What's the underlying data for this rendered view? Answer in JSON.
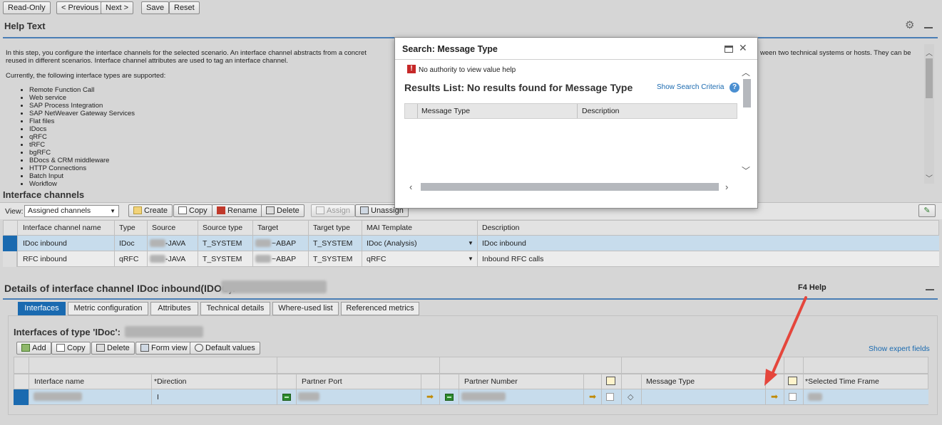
{
  "toolbar": {
    "readonly": "Read-Only",
    "previous": "< Previous",
    "next": "Next >",
    "save": "Save",
    "reset": "Reset"
  },
  "help": {
    "title": "Help Text",
    "para1_left": "In this step, you configure the interface channels for the selected scenario. An interface channel abstracts from a concret",
    "para1_right": "ween two technical systems or hosts. They can be",
    "para1_line2": "reused in different scenarios. Interface channel attributes are used to tag an interface channel.",
    "para2": "Currently, the following interface types are supported:",
    "types": [
      "Remote Function Call",
      "Web service",
      "SAP Process Integration",
      "SAP NetWeaver Gateway Services",
      "Flat files",
      "IDocs",
      "qRFC",
      "tRFC",
      "bgRFC",
      "BDocs & CRM middleware",
      "HTTP Connections",
      "Batch Input",
      "Workflow"
    ]
  },
  "channels": {
    "title": "Interface channels",
    "view_label": "View:",
    "view_value": "Assigned channels",
    "buttons": {
      "create": "Create",
      "copy": "Copy",
      "rename": "Rename",
      "delete": "Delete",
      "assign": "Assign",
      "unassign": "Unassign"
    },
    "columns": [
      "Interface channel name",
      "Type",
      "Source",
      "Source type",
      "Target",
      "Target type",
      "MAI Template",
      "Description"
    ],
    "rows": [
      {
        "name": "IDoc inbound",
        "type": "IDoc",
        "source": "-JAVA",
        "source_type": "T_SYSTEM",
        "target": "~ABAP",
        "target_type": "T_SYSTEM",
        "template": "IDoc (Analysis)",
        "description": "IDoc inbound"
      },
      {
        "name": "RFC inbound",
        "type": "qRFC",
        "source": "-JAVA",
        "source_type": "T_SYSTEM",
        "target": "~ABAP",
        "target_type": "T_SYSTEM",
        "template": "qRFC",
        "description": "Inbound RFC calls"
      }
    ]
  },
  "details": {
    "title": "Details of interface channel IDoc inbound(IDOC):",
    "annotation": "F4 Help",
    "tabs": [
      "Interfaces",
      "Metric configuration",
      "Attributes",
      "Technical details",
      "Where-used list",
      "Referenced metrics"
    ],
    "subtitle": "Interfaces of type 'IDoc':",
    "buttons": {
      "add": "Add",
      "copy": "Copy",
      "delete": "Delete",
      "form_view": "Form view",
      "default_values": "Default values"
    },
    "show_expert": "Show expert fields",
    "columns": {
      "interface_name": "Interface name",
      "direction": "*Direction",
      "partner_port": "Partner Port",
      "partner_number": "Partner Number",
      "message_type": "Message Type",
      "time_frame": "*Selected Time Frame"
    },
    "row": {
      "direction": "I"
    }
  },
  "dialog": {
    "title": "Search: Message Type",
    "error": "No authority to view value help",
    "results_title": "Results List: No results found for Message Type",
    "show_criteria": "Show Search Criteria",
    "columns": [
      "Message Type",
      "Description"
    ]
  },
  "colors": {
    "accent": "#1a6ab0",
    "rule": "#4a7eb5",
    "arrow": "#e5463c",
    "selection": "#c7dcec"
  }
}
